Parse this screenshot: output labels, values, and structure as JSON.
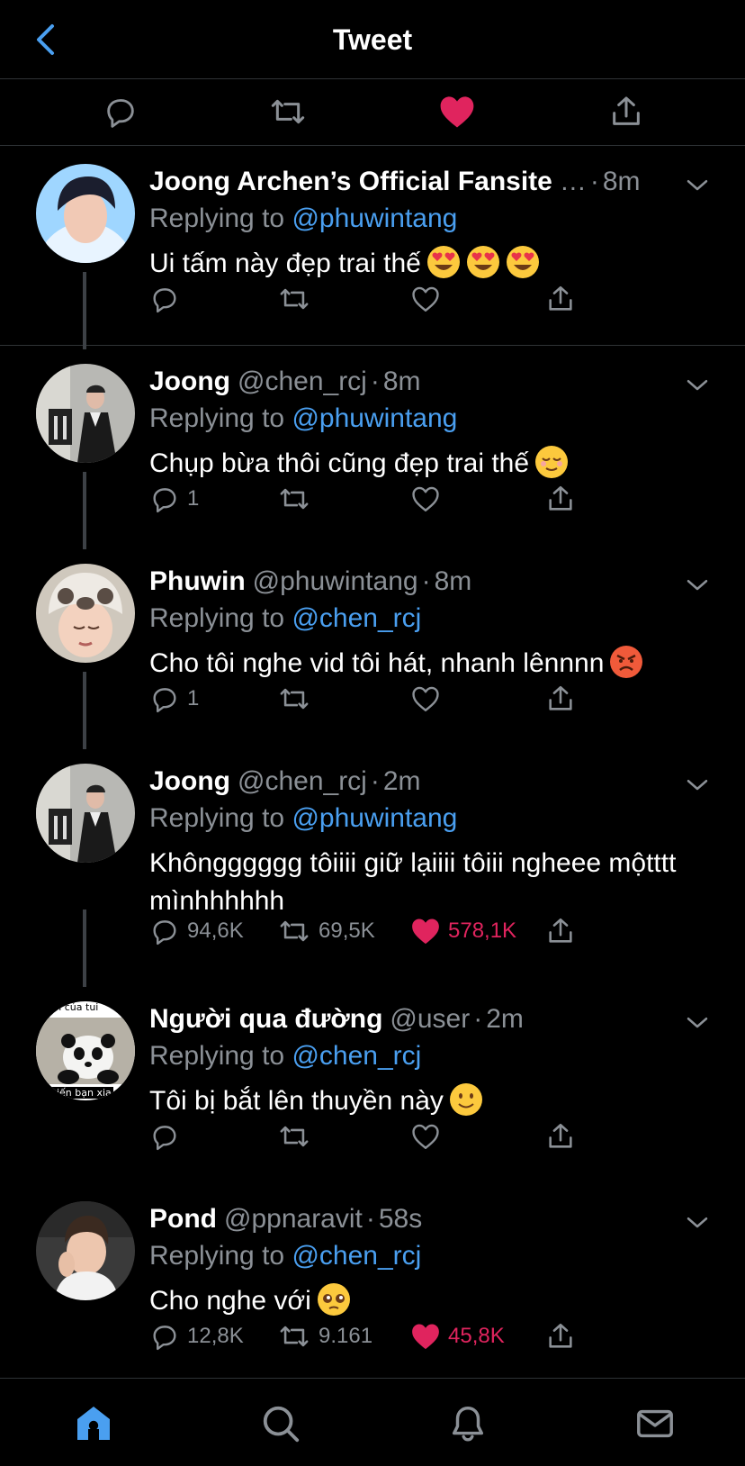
{
  "header": {
    "title": "Tweet"
  },
  "colors": {
    "accent": "#4a9ff0",
    "like": "#e0245e",
    "muted": "#8b9096",
    "background": "#000000"
  },
  "tweets": [
    {
      "name": "Joong Archen’s Official Fansite",
      "handle": "",
      "truncated": "…",
      "time": "8m",
      "replying_label": "Replying to",
      "replying_to": "@phuwintang",
      "text": "Ui tấm này đẹp trai thế",
      "emoji": [
        "heart-eyes-emoji",
        "heart-eyes-emoji",
        "heart-eyes-emoji"
      ],
      "counts": {
        "reply": "",
        "retweet": "",
        "like": ""
      },
      "liked": false
    },
    {
      "name": "Joong",
      "handle": "@chen_rcj",
      "time": "8m",
      "replying_label": "Replying to",
      "replying_to": "@phuwintang",
      "text": "Chụp bừa thôi cũng đẹp trai thế",
      "emoji": [
        "relieved-emoji"
      ],
      "counts": {
        "reply": "1",
        "retweet": "",
        "like": ""
      },
      "liked": false
    },
    {
      "name": "Phuwin",
      "handle": "@phuwintang",
      "time": "8m",
      "replying_label": "Replying to",
      "replying_to": "@chen_rcj",
      "text": "Cho tôi nghe vid tôi hát, nhanh lênnnn",
      "emoji": [
        "angry-emoji"
      ],
      "counts": {
        "reply": "1",
        "retweet": "",
        "like": ""
      },
      "liked": false
    },
    {
      "name": "Joong",
      "handle": "@chen_rcj",
      "time": "2m",
      "replying_label": "Replying to",
      "replying_to": "@phuwintang",
      "text": "Khôngggggg tôiiii giữ lạiiii tôiii ngheee mộtttt mìnhhhhhh",
      "emoji": [],
      "counts": {
        "reply": "94,6K",
        "retweet": "69,5K",
        "like": "578,1K"
      },
      "liked": true
    },
    {
      "name": "Người qua đường",
      "handle": "@user",
      "time": "2m",
      "replying_label": "Replying to",
      "replying_to": "@chen_rcj",
      "text": "Tôi bị bắt lên thuyền này",
      "emoji": [
        "slight-smile-emoji"
      ],
      "avatar_caption_top": "yện của tui",
      "avatar_caption_bottom": "hiến bạn xia",
      "counts": {
        "reply": "",
        "retweet": "",
        "like": ""
      },
      "liked": false
    },
    {
      "name": "Pond",
      "handle": "@ppnaravit",
      "time": "58s",
      "replying_label": "Replying to",
      "replying_to": "@chen_rcj",
      "text": "Cho nghe với",
      "emoji": [
        "pleading-emoji"
      ],
      "counts": {
        "reply": "12,8K",
        "retweet": "9.161",
        "like": "45,8K"
      },
      "liked": true
    }
  ],
  "tabbar": [
    "home-icon",
    "search-icon",
    "notifications-icon",
    "messages-icon"
  ]
}
